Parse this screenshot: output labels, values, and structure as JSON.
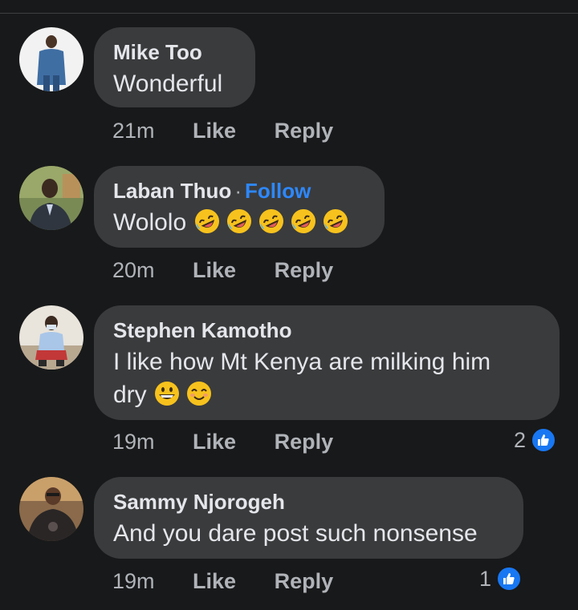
{
  "comments": [
    {
      "author": "Mike Too",
      "follow_label": "",
      "text": "Wonderful",
      "time": "21m",
      "like_label": "Like",
      "reply_label": "Reply",
      "reaction_count": "",
      "avatar_icon": "profile-photo-man-denim-shirt"
    },
    {
      "author": "Laban Thuo",
      "follow_label": "Follow",
      "text": "Wololo",
      "emojis": [
        "rolling-on-floor-laughing",
        "rolling-on-floor-laughing",
        "rolling-on-floor-laughing",
        "rolling-on-floor-laughing",
        "rolling-on-floor-laughing"
      ],
      "time": "20m",
      "like_label": "Like",
      "reply_label": "Reply",
      "reaction_count": "",
      "avatar_icon": "profile-photo-man-suit"
    },
    {
      "author": "Stephen Kamotho",
      "follow_label": "",
      "text_line1": "I like how Mt Kenya are milking him",
      "text_line2": "dry",
      "emojis": [
        "grinning-face",
        "smiling-face-with-smiling-eyes"
      ],
      "time": "19m",
      "like_label": "Like",
      "reply_label": "Reply",
      "reaction_count": "2",
      "avatar_icon": "profile-photo-man-squatting-mask"
    },
    {
      "author": "Sammy Njorogeh",
      "follow_label": "",
      "text": "And you dare post such nonsense",
      "time": "19m",
      "like_label": "Like",
      "reply_label": "Reply",
      "reaction_count": "1",
      "avatar_icon": "profile-photo-man-dark-shirt"
    }
  ],
  "colors": {
    "background": "#18191a",
    "bubble": "#3a3b3c",
    "follow": "#2d88ff",
    "like_badge": "#1877f2",
    "secondary_text": "#b0b3b8"
  }
}
